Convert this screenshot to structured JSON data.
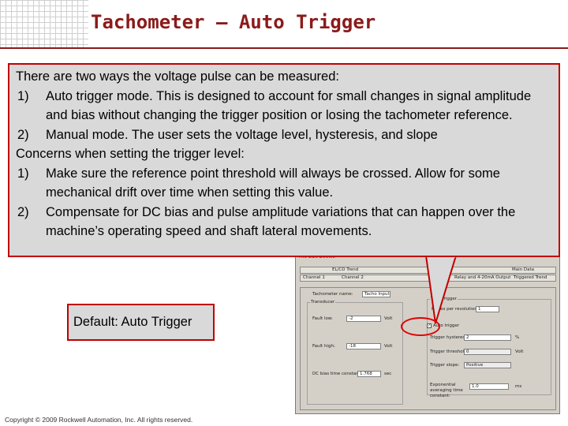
{
  "slide": {
    "title": "Tachometer – Auto Trigger",
    "callout": {
      "intro": "There are two ways the voltage pulse can be measured:",
      "item1_num": "1)",
      "item1": "Auto trigger mode. This is designed to account for small changes in signal amplitude and bias without changing the trigger position or losing the tachometer reference.",
      "item2_num": "2)",
      "item2": "Manual mode. The user sets the voltage level, hysteresis, and slope",
      "concerns": "Concerns when setting the trigger level:",
      "concern1_num": "1)",
      "concern1": "Make sure the reference point threshold will always be crossed. Allow for some mechanical drift over time when setting this value.",
      "concern2_num": "2)",
      "concern2": "Compensate for DC bias and pulse amplitude variations that can happen over the machine’s operating speed and shaft lateral movements."
    },
    "default_label": "Default: Auto Trigger",
    "copyright": "Copyright © 2009 Rockwell Automation, Inc. All rights reserved."
  },
  "dialog": {
    "menu": "File  Edit  Device",
    "tabs_row1": [
      "EL/CD Trend",
      "Main Data"
    ],
    "tabs_row2": [
      "Channel 1",
      "Channel 2",
      "Relay and 4-20mA Output",
      "Triggered Trend"
    ],
    "tacho_name_label": "Tachometer name:",
    "tacho_name_value": "Tacho Input",
    "transducer_label": "Transducer",
    "fault_low_label": "Fault low:",
    "fault_low_value": "-2",
    "fault_high_label": "Fault high:",
    "fault_high_value": "-18",
    "volt_unit": "Volt",
    "dc_bias_label": "DC bias time constant:",
    "dc_bias_value": "1.768",
    "sec_unit": "sec",
    "group_label": "Tach Trigger",
    "pulses_label": "Pulses per revolution:",
    "pulses_value": "1",
    "auto_trigger_label": "Auto trigger",
    "auto_trigger_checked": "✓",
    "hysteresis_label": "Trigger hysteresis:",
    "hysteresis_value": "2",
    "percent_unit": "%",
    "threshold_label": "Trigger threshold:",
    "threshold_value": "0",
    "slope_label": "Trigger slope:",
    "slope_value": "Positive",
    "exp_label": "Exponential averaging time constant:",
    "exp_value": "1.0",
    "ms_unit": "ms"
  }
}
